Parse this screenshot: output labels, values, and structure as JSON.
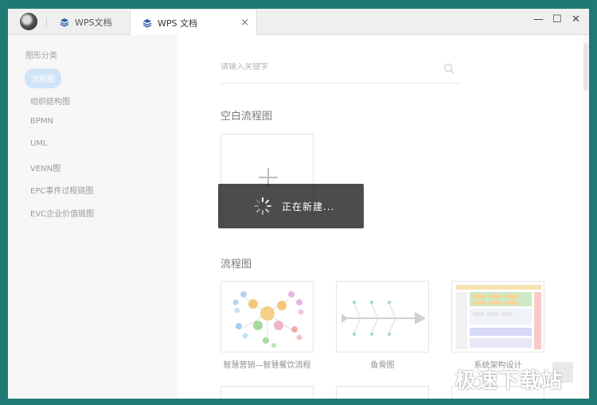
{
  "tabs": [
    {
      "label": "WPS文档"
    },
    {
      "label": "WPS 文档"
    }
  ],
  "window_controls": {
    "minimize": "—",
    "maximize": "☐",
    "close": "✕"
  },
  "tab_close": "×",
  "sidebar": {
    "title": "图形分类",
    "items": [
      {
        "label": "流程图",
        "active": true
      },
      {
        "label": "组织结构图"
      },
      {
        "label": "BPMN"
      },
      {
        "label": "UML"
      },
      {
        "label": "VENN图"
      },
      {
        "label": "EPC事件过程链图"
      },
      {
        "label": "EVC企业价值链图"
      }
    ]
  },
  "search": {
    "placeholder": "请输入关键字"
  },
  "sections": {
    "blank": "空白流程图",
    "flowchart": "流程图"
  },
  "templates": [
    {
      "label": "智慧营销—智慧餐饮流程"
    },
    {
      "label": "鱼骨图"
    },
    {
      "label": "系统架构设计"
    }
  ],
  "loading": {
    "text": "正在新建..."
  },
  "watermark": {
    "text": "极速下载站"
  },
  "colors": {
    "accent": "#cfe4f6",
    "background": "#1e7a73",
    "overlay": "#3a3a3a",
    "tab_icon": "#2f5ea8"
  }
}
